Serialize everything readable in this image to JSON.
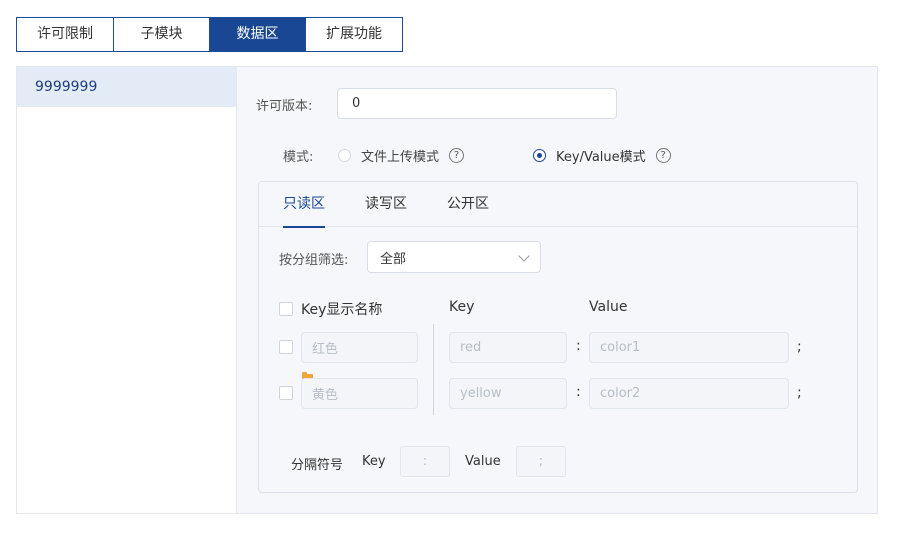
{
  "tabs": [
    "许可限制",
    "子模块",
    "数据区",
    "扩展功能"
  ],
  "active_tab": "数据区",
  "sidebar": {
    "items": [
      {
        "label": "9999999"
      }
    ]
  },
  "license": {
    "label": "许可版本:",
    "value": "0"
  },
  "mode": {
    "label": "模式:",
    "options": [
      {
        "label": "文件上传模式",
        "checked": false
      },
      {
        "label": "Key/Value模式",
        "checked": true
      }
    ],
    "help_icon": "?"
  },
  "data_tabs": [
    "只读区",
    "读写区",
    "公开区"
  ],
  "active_data_tab": "只读区",
  "filter": {
    "label": "按分组筛选:",
    "value": "全部"
  },
  "table": {
    "display_name_header": "Key显示名称",
    "key_header": "Key",
    "value_header": "Value",
    "rows": [
      {
        "name_placeholder": "红色",
        "key_placeholder": "red",
        "value_placeholder": "color1"
      },
      {
        "name_placeholder": "黄色",
        "key_placeholder": "yellow",
        "value_placeholder": "color2"
      }
    ],
    "kv_colon": ":",
    "row_end": ";"
  },
  "separator": {
    "label": "分隔符号",
    "key_label": "Key",
    "key_value": ":",
    "value_label": "Value",
    "value_value": ";"
  },
  "colors": {
    "primary": "#1a4794",
    "panel_bg": "#f5f7fa",
    "sidebar_active": "#e3ebf7",
    "folder": "#f0a53a"
  }
}
